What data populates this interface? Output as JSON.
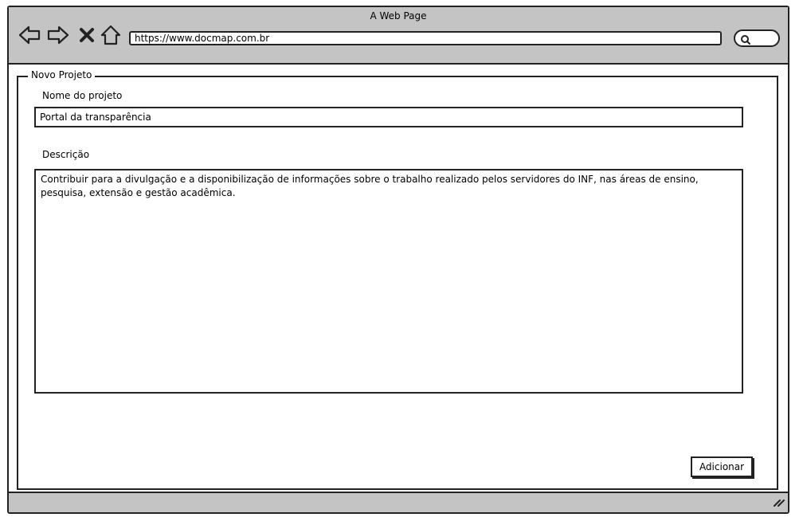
{
  "window": {
    "title": "A Web Page"
  },
  "toolbar": {
    "back_icon": "back-arrow-icon",
    "forward_icon": "forward-arrow-icon",
    "stop_icon": "close-x-icon",
    "home_icon": "home-icon",
    "url": "https://www.docmap.com.br",
    "search_icon": "search-icon"
  },
  "form": {
    "legend": "Novo Projeto",
    "name_label": "Nome do projeto",
    "name_value": "Portal da transparência",
    "description_label": "Descrição",
    "description_value": "Contribuir para a divulgação e a disponibilização de informações sobre o trabalho realizado pelos servidores do INF, nas áreas de ensino, pesquisa, extensão e gestão acadêmica.",
    "submit_label": "Adicionar"
  },
  "colors": {
    "chrome": "#c4c4c4",
    "border": "#222222",
    "background": "#ffffff"
  }
}
